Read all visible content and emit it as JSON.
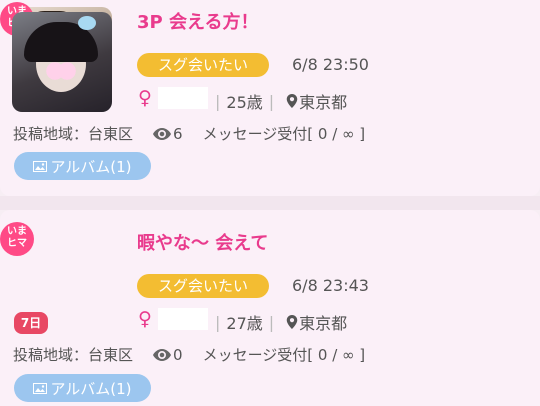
{
  "posts": [
    {
      "badge": "いま\nヒマ",
      "title": "3P 会える方！",
      "tag": "スグ会いたい",
      "datetime": "6/8 23:50",
      "gender_symbol": "♀",
      "age": "25歳",
      "location": "東京都",
      "area": "投稿地域：台東区",
      "views": "6",
      "message_status": "メッセージ受付[ 0 / ∞ ]",
      "album": "アルバム(1)"
    },
    {
      "badge": "いま\nヒマ",
      "title": "暇やな～ 会えて",
      "tag": "スグ会いたい",
      "datetime": "6/8 23:43",
      "gender_symbol": "♀",
      "age": "27歳",
      "location": "東京都",
      "area": "投稿地域：台東区",
      "views": "0",
      "message_status": "メッセージ受付[ 0 / ∞ ]",
      "album": "アルバム(1)",
      "new_badge": "7日"
    }
  ],
  "colors": {
    "accent": "#e93b8d",
    "tag_bg": "#f3bd32",
    "album_bg": "#9cc6ef",
    "card_bg": "#fbf0f8"
  },
  "icons": [
    "image-icon",
    "eye-icon",
    "map-pin-icon",
    "female-icon"
  ]
}
